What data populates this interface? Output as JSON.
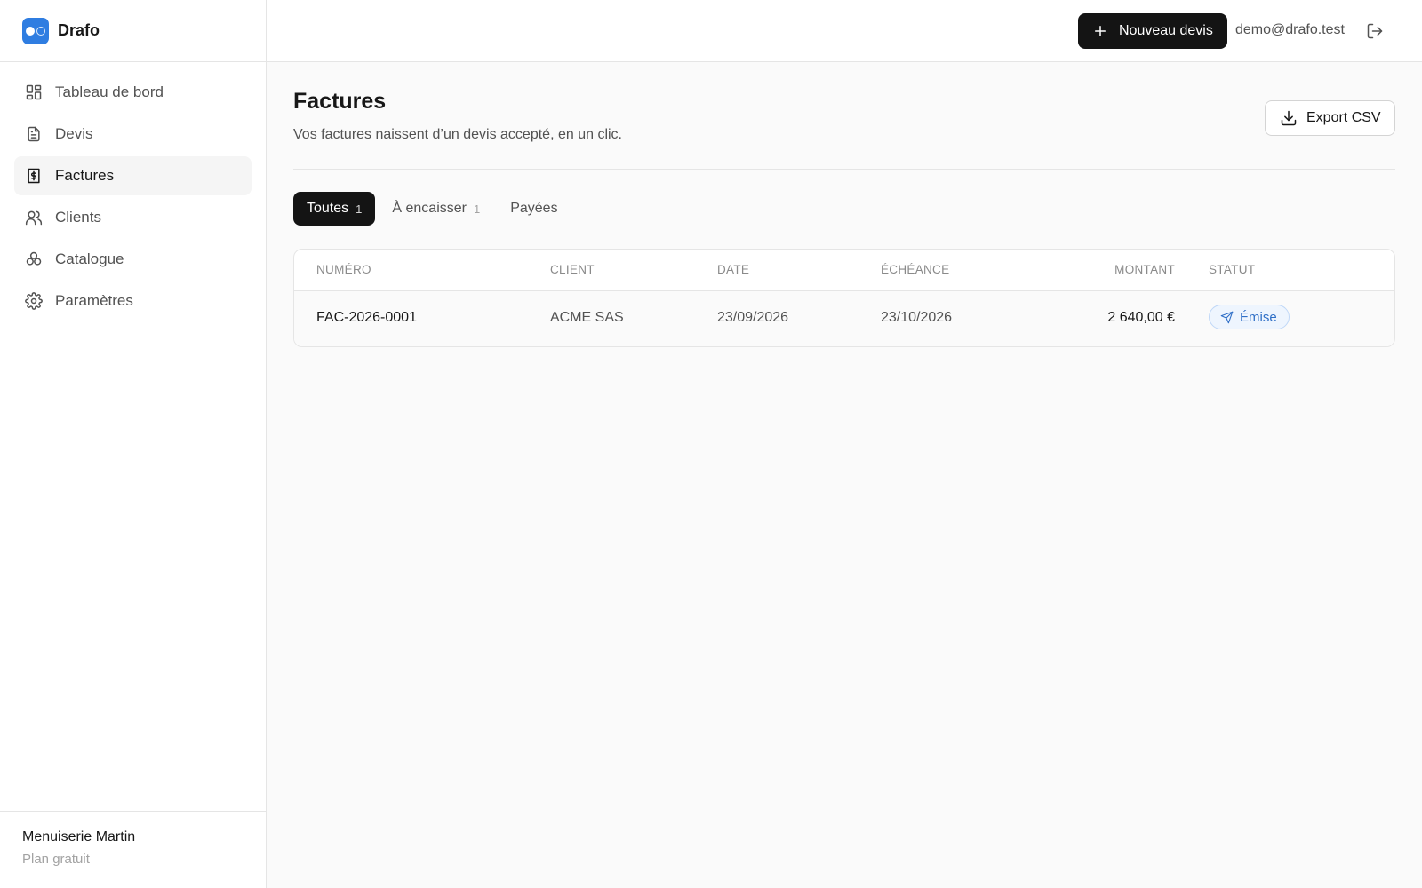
{
  "brand": {
    "name": "Drafo",
    "accent": "#2f7de1"
  },
  "sidebar": {
    "items": [
      {
        "label": "Tableau de bord",
        "icon": "dashboard-icon"
      },
      {
        "label": "Devis",
        "icon": "document-icon"
      },
      {
        "label": "Factures",
        "icon": "invoice-icon",
        "active": true
      },
      {
        "label": "Clients",
        "icon": "users-icon"
      },
      {
        "label": "Catalogue",
        "icon": "boxes-icon"
      },
      {
        "label": "Paramètres",
        "icon": "gear-icon"
      }
    ],
    "footer": {
      "org": "Menuiserie Martin",
      "plan": "Plan gratuit"
    }
  },
  "topbar": {
    "new_quote_label": "Nouveau devis",
    "user_email": "demo@drafo.test"
  },
  "page": {
    "title": "Factures",
    "subtitle": "Vos factures naissent d’un devis accepté, en un clic.",
    "export_label": "Export CSV"
  },
  "tabs": [
    {
      "label": "Toutes",
      "count": "1",
      "active": true
    },
    {
      "label": "À encaisser",
      "count": "1"
    },
    {
      "label": "Payées",
      "count": ""
    }
  ],
  "table": {
    "columns": {
      "number": "NUMÉRO",
      "client": "CLIENT",
      "date": "DATE",
      "due": "ÉCHÉANCE",
      "amount": "MONTANT",
      "status": "STATUT"
    },
    "rows": [
      {
        "number": "FAC-2026-0001",
        "client": "ACME SAS",
        "date": "23/09/2026",
        "due": "23/10/2026",
        "amount": "2 640,00 €",
        "status": "Émise",
        "status_color": "#2f6fc7"
      }
    ]
  }
}
